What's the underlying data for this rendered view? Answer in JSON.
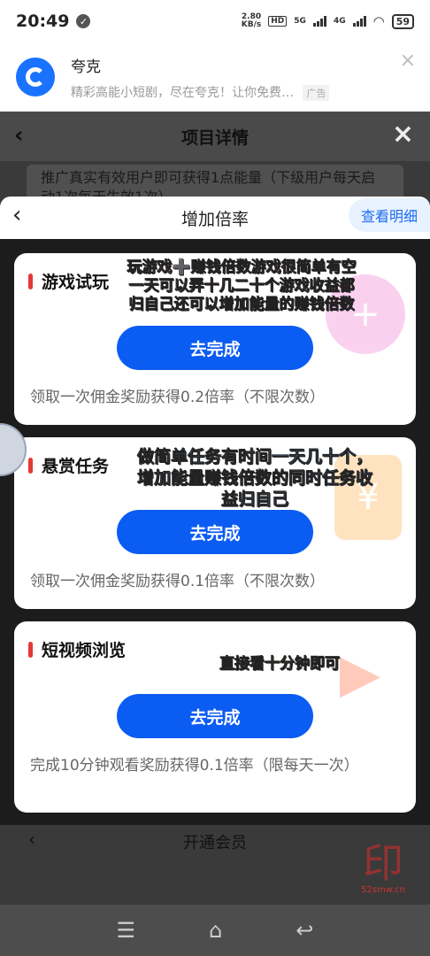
{
  "status": {
    "time": "20:49",
    "speed_value": "2.80",
    "speed_unit": "KB/s",
    "hd": "HD",
    "net5g": "5G",
    "net4g": "4G",
    "battery": "59"
  },
  "ad": {
    "app_name": "夸克",
    "description": "精彩高能小短剧，尽在夸克！让你免费…",
    "tag": "广告",
    "close": "×"
  },
  "background": {
    "title": "项目详情",
    "card_text": "推广真实有效用户即可获得1点能量（下级用户每天启动1次每天生效1次）",
    "bottom_title": "开通会员",
    "bottom_fragment": "次）"
  },
  "sheet": {
    "title": "增加倍率",
    "detail_button": "查看明细"
  },
  "tasks": [
    {
      "title": "游戏试玩",
      "button": "去完成",
      "desc": "领取一次佣金奖励获得0.2倍率（不限次数）",
      "note": "玩游戏➕赚钱倍数游戏很简单有空一天可以弄十几二十个游戏收益都归自己还可以增加能量的赚钱倍数"
    },
    {
      "title": "悬赏任务",
      "button": "去完成",
      "desc": "领取一次佣金奖励获得0.1倍率（不限次数）",
      "note": "做简单任务有时间一天几十个，增加能量赚钱倍数的同时任务收益归自己"
    },
    {
      "title": "短视频浏览",
      "button": "去完成",
      "desc": "完成10分钟观看奖励获得0.1倍率（限每天一次）",
      "note": "直接看十分钟即可"
    }
  ],
  "watermark": {
    "site": "52smw.cn"
  },
  "icons": {
    "back": "chevron-left-icon",
    "close": "close-icon",
    "menu": "menu-icon",
    "home": "home-icon",
    "return": "back-arrow-icon"
  },
  "colors": {
    "accent": "#0b5cf3",
    "marker": "#e53935",
    "detail_text": "#1d6cf2"
  }
}
